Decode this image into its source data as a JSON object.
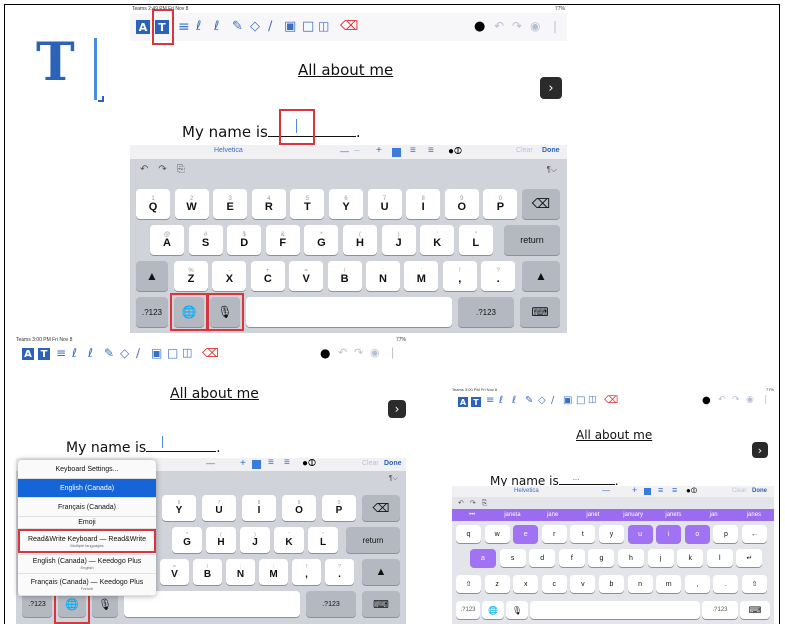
{
  "main": {
    "status": {
      "left": "Teams  2:49 PM  Fri Nov 8",
      "right": "77%"
    },
    "title": "All about me",
    "name_prompt": "My name is",
    "name_suffix": ".",
    "format_bar": {
      "font": "Helvetica",
      "minus": "—",
      "dots": "...",
      "plus": "+",
      "clear": "Clear",
      "done": "Done"
    },
    "para_mark": "¶⌵",
    "keyboard": {
      "row1": [
        {
          "sub": "1",
          "main": "Q"
        },
        {
          "sub": "2",
          "main": "W"
        },
        {
          "sub": "3",
          "main": "E"
        },
        {
          "sub": "4",
          "main": "R"
        },
        {
          "sub": "5",
          "main": "T"
        },
        {
          "sub": "6",
          "main": "Y"
        },
        {
          "sub": "7",
          "main": "U"
        },
        {
          "sub": "8",
          "main": "I"
        },
        {
          "sub": "9",
          "main": "O"
        },
        {
          "sub": "0",
          "main": "P"
        }
      ],
      "row2": [
        {
          "sub": "@",
          "main": "A"
        },
        {
          "sub": "#",
          "main": "S"
        },
        {
          "sub": "$",
          "main": "D"
        },
        {
          "sub": "&",
          "main": "F"
        },
        {
          "sub": "*",
          "main": "G"
        },
        {
          "sub": "(",
          "main": "H"
        },
        {
          "sub": ")",
          "main": "J"
        },
        {
          "sub": "'",
          "main": "K"
        },
        {
          "sub": "\"",
          "main": "L"
        }
      ],
      "row3": [
        {
          "sub": "%",
          "main": "Z"
        },
        {
          "sub": "-",
          "main": "X"
        },
        {
          "sub": "+",
          "main": "C"
        },
        {
          "sub": "=",
          "main": "V"
        },
        {
          "sub": "/",
          "main": "B"
        },
        {
          "sub": ";",
          "main": "N"
        },
        {
          "sub": ":",
          "main": "M"
        },
        {
          "sub": "!",
          "main": ","
        },
        {
          "sub": "?",
          "main": "."
        }
      ],
      "return": "return",
      "numbers": ".?123"
    }
  },
  "icon_panel": {
    "letter": "T"
  },
  "panel_bl": {
    "status": {
      "left": "Teams  3:00 PM  Fri Nov 8",
      "right": "77%"
    },
    "title": "All about me",
    "name_prompt": "My name is",
    "name_suffix": ".",
    "format_bar": {
      "clear": "Clear",
      "done": "Done"
    },
    "para_mark": "¶⌵",
    "menu": [
      {
        "label": "Keyboard Settings...",
        "sub": ""
      },
      {
        "label": "English (Canada)",
        "sub": ""
      },
      {
        "label": "Français (Canada)",
        "sub": ""
      },
      {
        "label": "Emoji",
        "sub": ""
      },
      {
        "label": "Read&Write Keyboard — Read&Write",
        "sub": "Multiple languages"
      },
      {
        "label": "English (Canada) — Keedogo Plus",
        "sub": "English"
      },
      {
        "label": "Français (Canada) — Keedogo Plus",
        "sub": "French"
      }
    ],
    "keys_r1": [
      {
        "sub": "6",
        "main": "Y"
      },
      {
        "sub": "7",
        "main": "U"
      },
      {
        "sub": "8",
        "main": "I"
      },
      {
        "sub": "9",
        "main": "O"
      },
      {
        "sub": "0",
        "main": "P"
      }
    ],
    "keys_r2": [
      {
        "sub": "*",
        "main": "G"
      },
      {
        "sub": "(",
        "main": "H"
      },
      {
        "sub": ")",
        "main": "J"
      },
      {
        "sub": "'",
        "main": "K"
      },
      {
        "sub": "\"",
        "main": "L"
      }
    ],
    "keys_r3": [
      {
        "sub": "=",
        "main": "V"
      },
      {
        "sub": "/",
        "main": "B"
      },
      {
        "sub": ";",
        "main": "N"
      },
      {
        "sub": ":",
        "main": "M"
      },
      {
        "sub": "!",
        "main": ","
      },
      {
        "sub": "?",
        "main": "."
      }
    ],
    "return": "return",
    "numbers": ".?123"
  },
  "panel_br": {
    "status": {
      "left": "Teams  3:00 PM  Fri Nov 8",
      "right": "77%"
    },
    "title": "All about me",
    "name_prompt": "My name is",
    "typed": "...",
    "name_suffix": ".",
    "format_bar": {
      "font": "Helvetica",
      "clear": "Clear",
      "done": "Done"
    },
    "suggestions": [
      "•••",
      "janeta",
      "jane",
      "janet",
      "january",
      "janets",
      "jan",
      "janes"
    ],
    "row1": [
      "q",
      "w",
      "e",
      "r",
      "t",
      "y",
      "u",
      "i",
      "o",
      "p",
      "←"
    ],
    "row2": [
      "a",
      "s",
      "d",
      "f",
      "g",
      "h",
      "j",
      "k",
      "l",
      "↵"
    ],
    "row3": [
      "⇧",
      "z",
      "x",
      "c",
      "v",
      "b",
      "n",
      "m",
      ",",
      ".",
      "⇧"
    ],
    "numbers": ".?123"
  },
  "colors": {
    "accent": "#2c62b8",
    "highlight_box": "#d8353f",
    "keyboard_bg": "#d0d3da",
    "suggest_bg": "#9c6cf0",
    "menu_selected": "#1565d8"
  }
}
